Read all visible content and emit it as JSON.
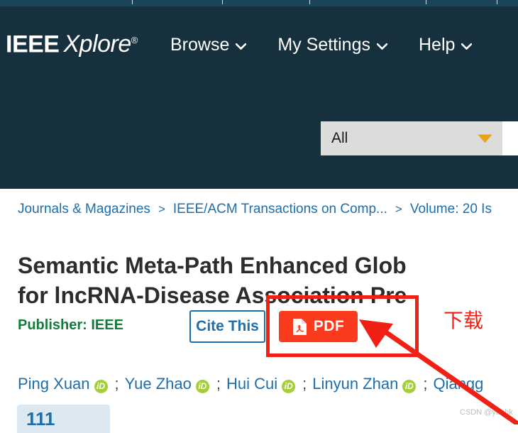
{
  "site": {
    "logo_ieee": "IEEE",
    "logo_xplore": "Xplore",
    "logo_reg": "®"
  },
  "top_strip": {
    "note": "partially cropped utility navigation bar"
  },
  "nav": {
    "items": [
      {
        "label": "Browse",
        "icon": "chevron-down-icon"
      },
      {
        "label": "My Settings",
        "icon": "chevron-down-icon"
      },
      {
        "label": "Help",
        "icon": "chevron-down-icon"
      }
    ]
  },
  "search": {
    "scope_selected": "All",
    "scope_icon": "chevron-down-icon",
    "input_value": "",
    "input_placeholder": ""
  },
  "breadcrumb": {
    "separator": ">",
    "items": [
      "Journals & Magazines",
      "IEEE/ACM Transactions on Comp...",
      "Volume: 20 Is"
    ]
  },
  "article": {
    "title_line1": "Semantic Meta-Path Enhanced Glob",
    "title_line2": "for lncRNA-Disease Association Pre",
    "publisher": "Publisher:  IEEE",
    "cite_label": "Cite This",
    "pdf_label": "PDF",
    "pdf_icon": "pdf-file-icon",
    "authors": [
      {
        "name": "Ping Xuan",
        "orcid": "iD"
      },
      {
        "name": "Yue Zhao",
        "orcid": "iD"
      },
      {
        "name": "Hui Cui",
        "orcid": "iD"
      },
      {
        "name": "Linyun Zhan",
        "orcid": "iD"
      },
      {
        "name": "Qiangg",
        "orcid": ""
      }
    ],
    "author_separator": ";"
  },
  "metrics": {
    "value": "111"
  },
  "annotation": {
    "chinese_label": "下载",
    "highlight_color": "#f02114",
    "arrow": "arrow-pointing-up-left"
  },
  "watermark": {
    "text": "CSDN @yunhk"
  },
  "colors": {
    "header_bg": "#17303e",
    "top_strip_bg": "#1b4659",
    "link_blue": "#1c6ead",
    "publisher_green": "#157a3c",
    "pdf_orange": "#fb3b1e",
    "scope_grey": "#dcdcdc",
    "scope_caret_gold": "#e8a317",
    "orcid_green": "#a6ce39",
    "chip_blue": "#dce9f2",
    "annotation_red": "#f02114"
  }
}
